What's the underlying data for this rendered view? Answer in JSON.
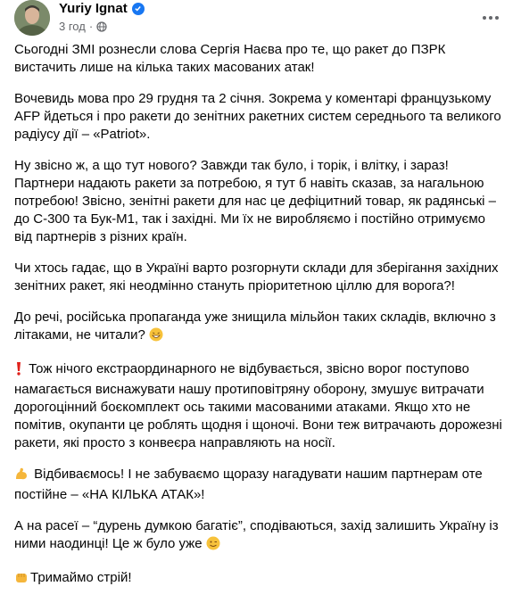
{
  "post": {
    "author": "Yuriy Ignat",
    "time": "3 год",
    "paragraphs": [
      "Сьогодні ЗМІ рознесли слова Сергія Наєва про те, що ракет до ПЗРК вистачить лише на кілька таких масованих атак!",
      "Вочевидь мова про 29 грудня та 2 січня. Зокрема у коментарі  французькому AFP йдеться і про ракети до зенітних ракетних систем середнього та великого радіусу дії – «Patriot».",
      "Ну звісно ж, а що тут нового? Завжди так було, і торік, і влітку, і зараз! Партнери надають ракети за потребою, я тут б навіть сказав, за нагальною потребою! Звісно, зенітні ракети для нас це дефіцитний товар, як радянські – до С-300 та Бук-М1, так і західні. Ми їх не виробляємо і постійно отримуємо від партнерів з різних країн.",
      "Чи хтось гадає, що в Україні варто розгорнути склади для зберігання західних зенітних ракет, які неодмінно стануть пріоритетною ціллю для ворога?!",
      "До речі, російська пропаганда уже знищила мільйон таких складів, включно з літаками, не читали?",
      "Тож нічого екстраординарного не відбувається, звісно  ворог поступово намагається виснажувати нашу протиповітряну оборону, змушує витрачати дорогоцінний боєкомплект ось такими масованими атаками. Якщо хто не помітив, окупанти це роблять щодня і щоночі. Вони теж витрачають дорожезні ракети, які просто з конвеєра направляють на носії.",
      "Відбиваємось! І не забуваємо щоразу нагадувати нашим партнерам оте постійне – «НА КІЛЬКА АТАК»!",
      "А на расеї  – “дурень думкою багатіє”, сподіваються, захід залишить Україну із ними наодинці! Це ж було уже",
      "Тримаймо стрій!"
    ]
  }
}
